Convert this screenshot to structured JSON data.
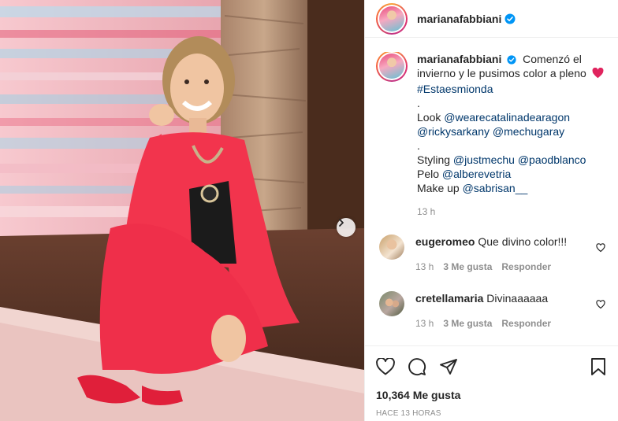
{
  "post": {
    "username": "marianafabbiani",
    "caption": {
      "lines": [
        "Comenzó el invierno y le pusimos color a pleno",
        "#Estaesmionda",
        ".",
        "Look",
        "@wearecatalinadearagon",
        "@rickysarkany",
        "@mechugaray",
        ".",
        "Styling",
        "@justmechu",
        "@paodblanco",
        "Pelo",
        "@alberevetria",
        "Make up",
        "@sabrisan__"
      ],
      "time": "13 h"
    },
    "comments": [
      {
        "username": "eugeromeo",
        "text": "Que divino color!!!",
        "time": "13 h",
        "likes": "3 Me gusta",
        "reply": "Responder"
      },
      {
        "username": "cretellamaria",
        "text": "Divinaaaaaa",
        "time": "13 h",
        "likes": "3 Me gusta",
        "reply": "Responder"
      }
    ],
    "likes_count": "10,364 Me gusta",
    "posted_ago": "Hace 13 horas"
  },
  "icons": {
    "verified": "verified-badge-icon",
    "heart_emoji": "red-heart-icon",
    "like": "heart-icon",
    "comment": "comment-icon",
    "share": "paper-plane-icon",
    "save": "bookmark-icon",
    "next": "chevron-right-icon"
  },
  "colors": {
    "link": "#00376b",
    "verified": "#0095f6",
    "muted": "#8e8e8e",
    "suit": "#f2344d"
  }
}
